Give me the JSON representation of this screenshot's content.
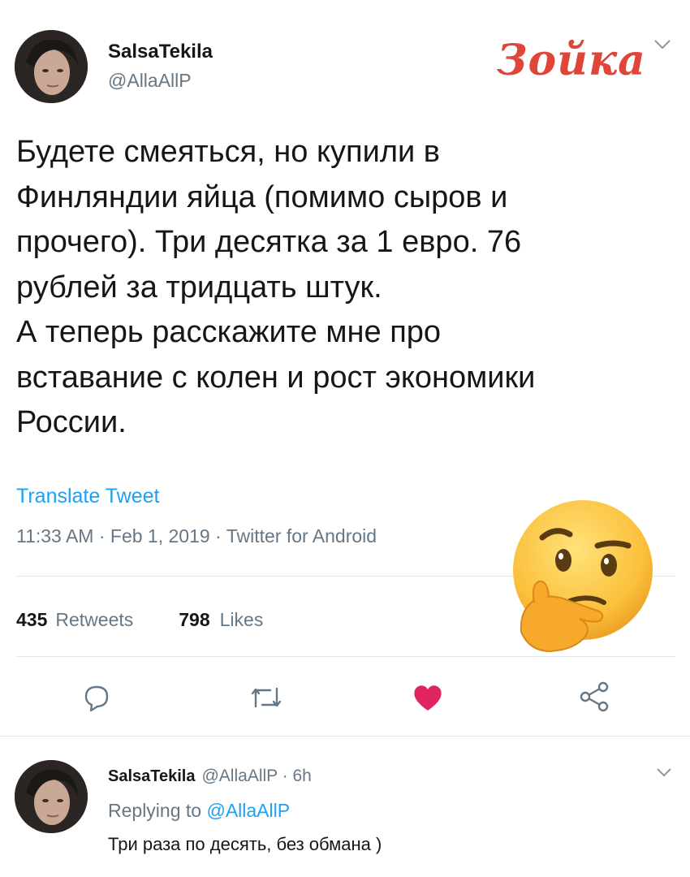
{
  "tweet": {
    "author_name": "SalsaTekila",
    "author_handle": "@AllaAllP",
    "text": "Будете смеяться, но купили в\nФинляндии яйца (помимо сыров и\nпрочего). Три десятка за 1 евро. 76\nрублей за тридцать штук.\nА теперь расскажите мне про\nвставание с колен и рост экономики\nРоссии.",
    "translate_label": "Translate Tweet",
    "timestamp": "11:33 AM · Feb 1, 2019 · Twitter for Android",
    "retweets_count": "435",
    "retweets_label": "Retweets",
    "likes_count": "798",
    "likes_label": "Likes"
  },
  "watermark": {
    "logo_text": "Зойка"
  },
  "actions": {
    "reply_icon": "comment-icon",
    "retweet_icon": "retweet-icon",
    "like_icon": "heart-icon",
    "share_icon": "share-icon",
    "like_color": "#e0245e"
  },
  "reply": {
    "author_name": "SalsaTekila",
    "meta": "@AllaAllP · 6h",
    "replying_prefix": "Replying to",
    "replying_handle": "@AllaAllP",
    "text": "Три раза по десять, без обмана )"
  },
  "colors": {
    "link": "#1da1f2",
    "secondary_text": "#657786",
    "divider": "#e1e8ed"
  }
}
